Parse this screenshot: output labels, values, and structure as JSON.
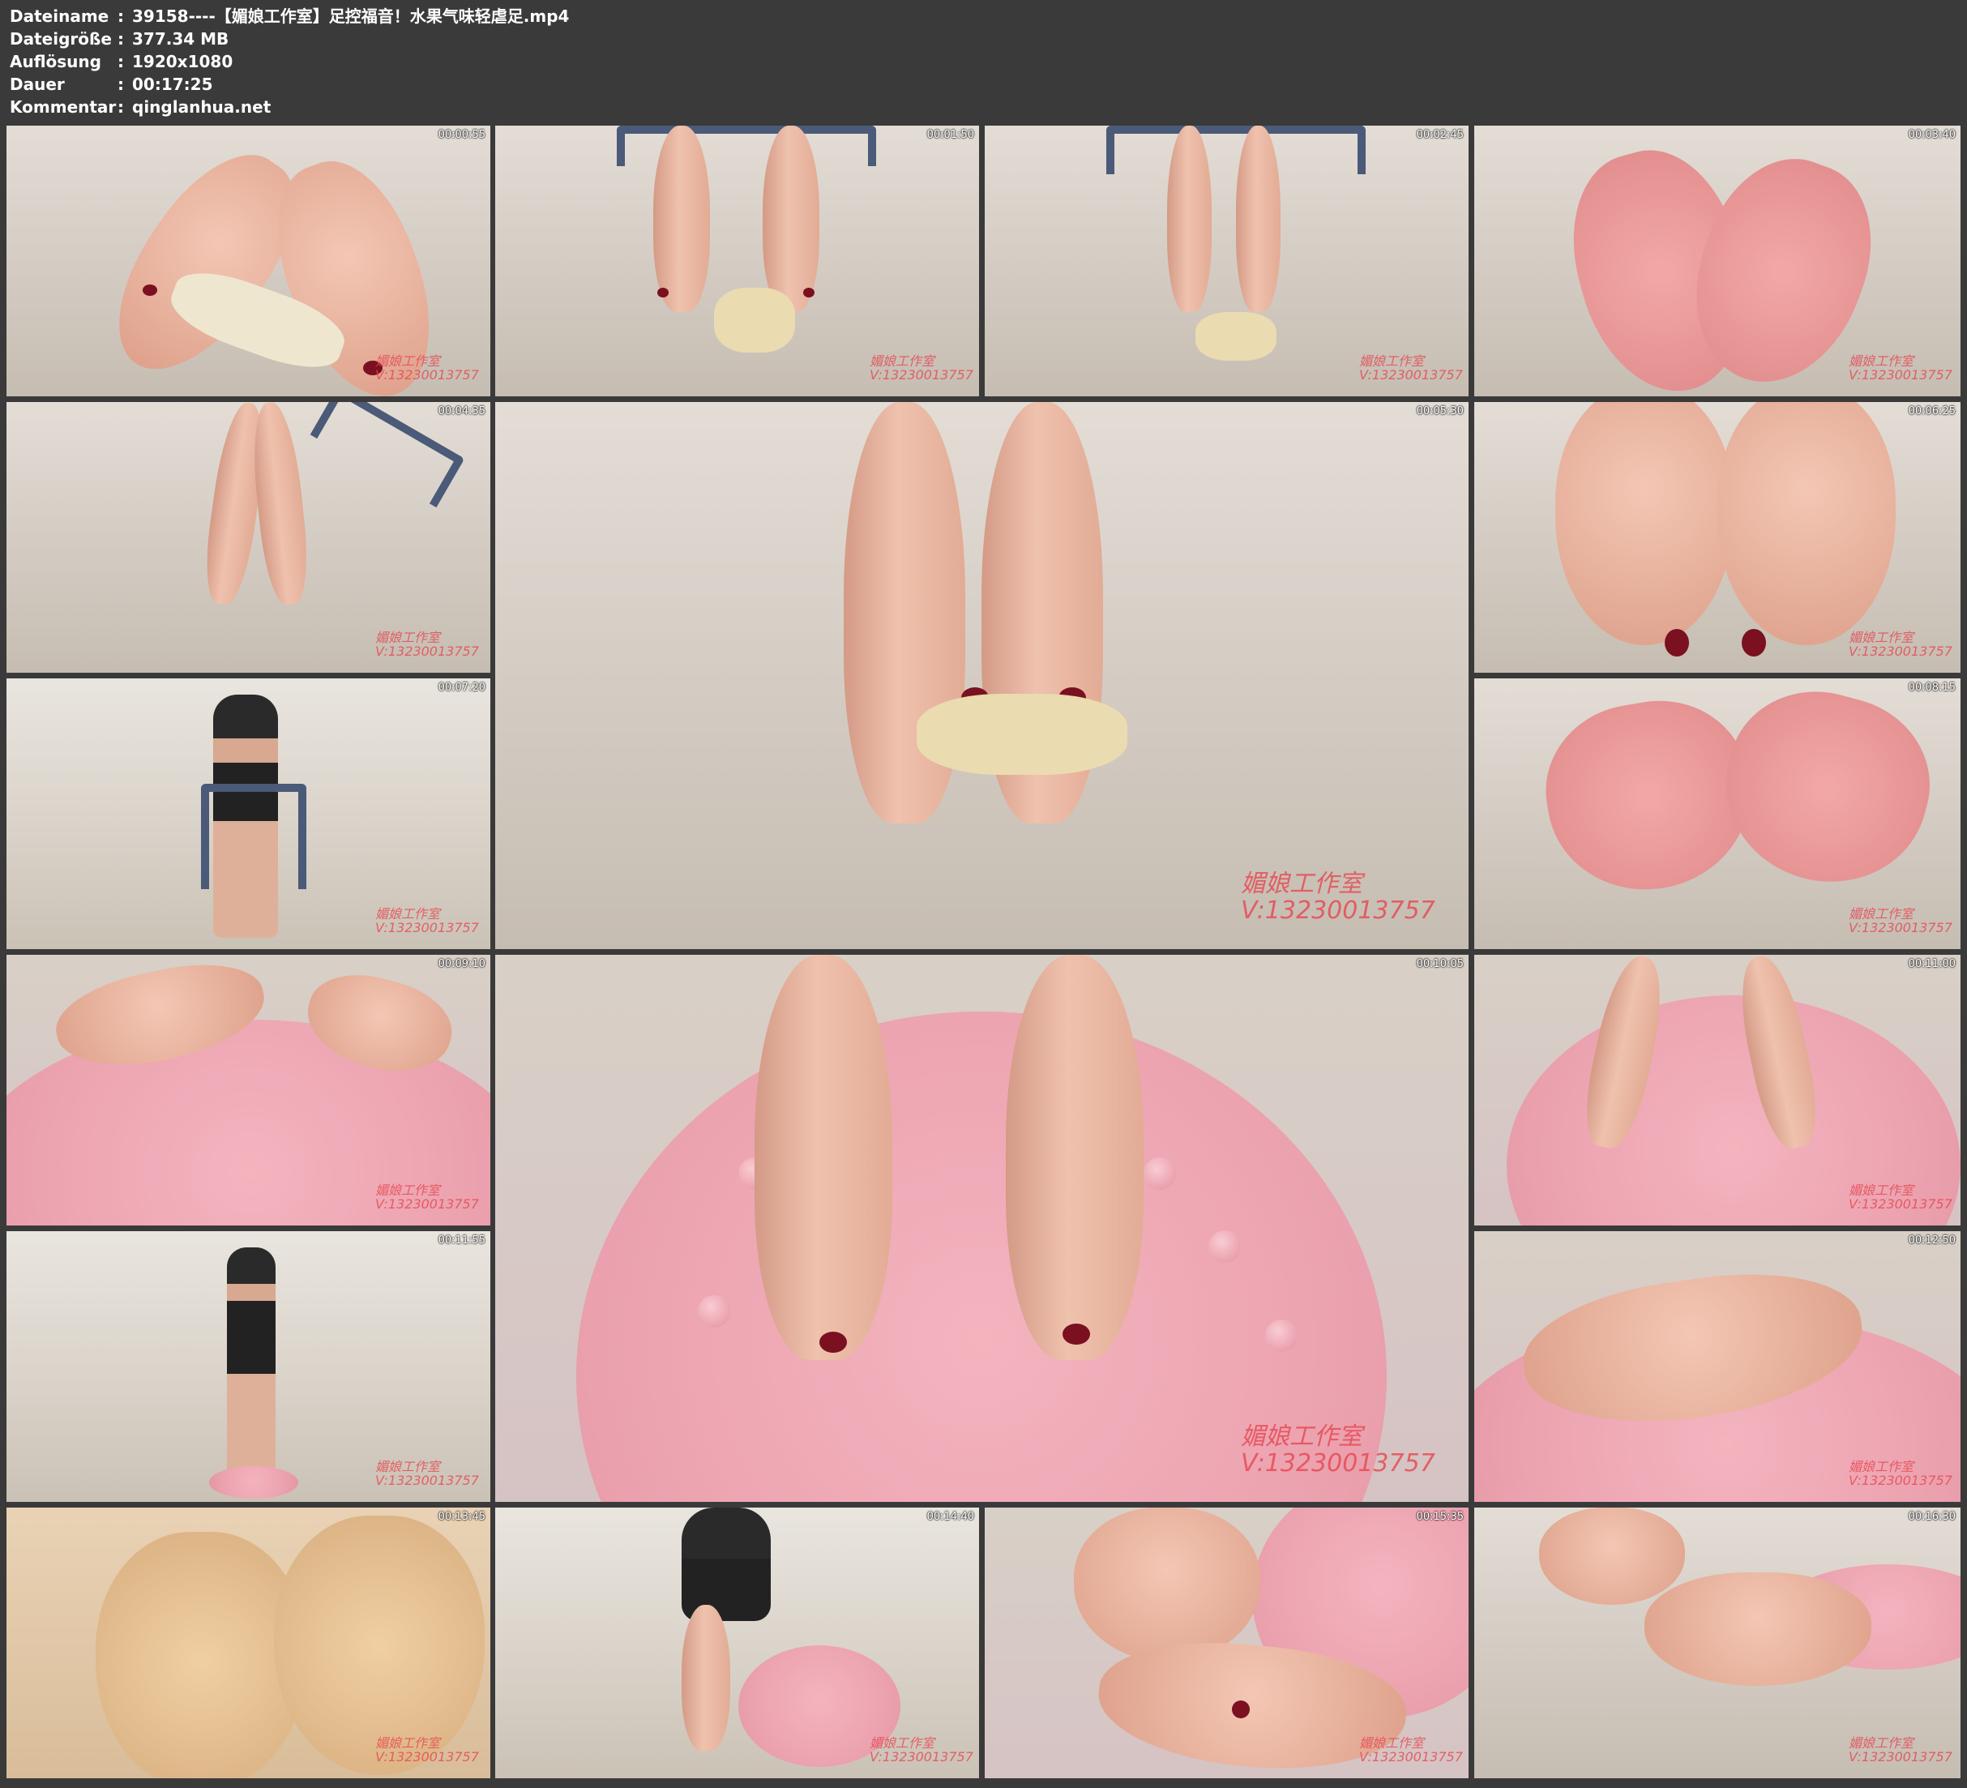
{
  "info": [
    {
      "key": "Dateiname",
      "sep": ":",
      "value": "39158----【媚娘工作室】足控福音！水果气味轻虐足.mp4"
    },
    {
      "key": "Dateigröße",
      "sep": ":",
      "value": "377.34 MB"
    },
    {
      "key": "Auflösung",
      "sep": ":",
      "value": "1920x1080"
    },
    {
      "key": "Dauer",
      "sep": ":",
      "value": "00:17:25"
    },
    {
      "key": "Kommentar",
      "sep": ":",
      "value": "qinglanhua.net"
    }
  ],
  "watermark": {
    "line1": "媚娘工作室",
    "line2": "V:13230013757"
  },
  "thumbnails": [
    {
      "timestamp": "00:00:55"
    },
    {
      "timestamp": "00:01:50"
    },
    {
      "timestamp": "00:02:45"
    },
    {
      "timestamp": "00:03:40"
    },
    {
      "timestamp": "00:04:35"
    },
    {
      "timestamp": "00:05:30"
    },
    {
      "timestamp": "00:06:25"
    },
    {
      "timestamp": "00:07:20"
    },
    {
      "timestamp": "00:08:15"
    },
    {
      "timestamp": "00:09:10"
    },
    {
      "timestamp": "00:10:05"
    },
    {
      "timestamp": "00:11:00"
    },
    {
      "timestamp": "00:11:55"
    },
    {
      "timestamp": "00:12:50"
    },
    {
      "timestamp": "00:13:45"
    },
    {
      "timestamp": "00:14:40"
    },
    {
      "timestamp": "00:15:35"
    },
    {
      "timestamp": "00:16:30"
    }
  ]
}
